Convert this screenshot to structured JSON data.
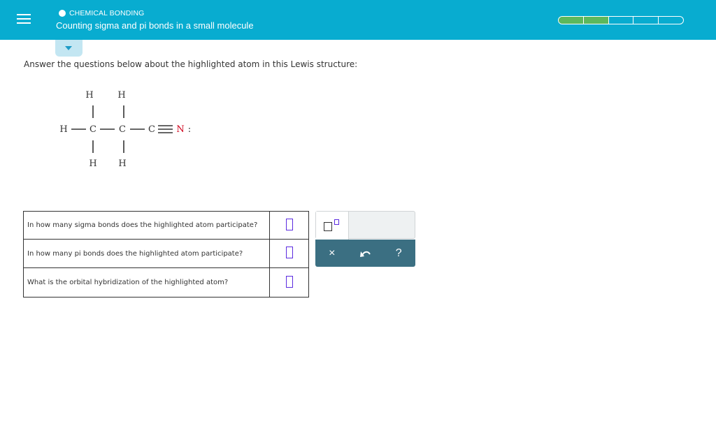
{
  "header": {
    "category": "CHEMICAL BONDING",
    "title": "Counting sigma and pi bonds in a small molecule",
    "progress": {
      "filled": 2,
      "total": 5
    }
  },
  "prompt": "Answer the questions below about the highlighted atom in this Lewis structure:",
  "lewis": {
    "H": "H",
    "C": "C",
    "N": "N",
    "lone_pair": ":",
    "highlight_color": "#d0021b"
  },
  "questions": [
    {
      "text": "In how many sigma bonds does the highlighted atom participate?",
      "answer": ""
    },
    {
      "text": "In how many pi bonds does the highlighted atom participate?",
      "answer": ""
    },
    {
      "text": "What is the orbital hybridization of the highlighted atom?",
      "answer": ""
    }
  ],
  "tools": {
    "superscript_icon": "superscript-icon",
    "clear_label": "×",
    "undo_icon": "undo-icon",
    "help_label": "?"
  }
}
